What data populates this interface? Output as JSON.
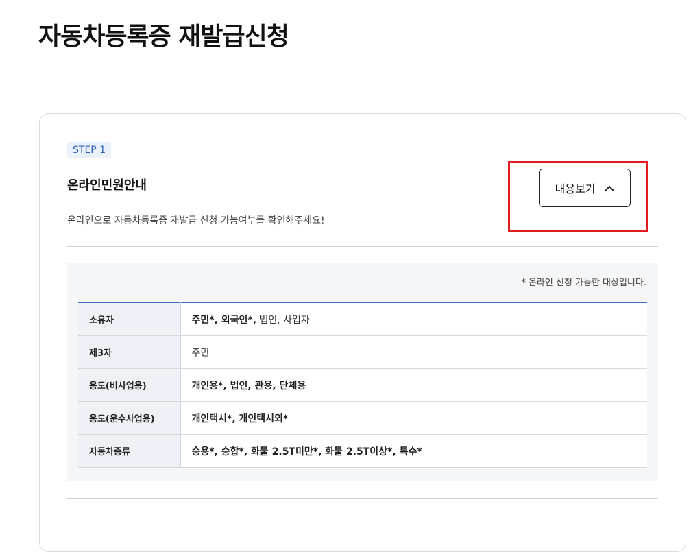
{
  "page": {
    "title": "자동차등록증 재발급신청"
  },
  "step": {
    "badge": "STEP 1",
    "title": "온라인민원안내",
    "description": "온라인으로 자동차등록증 재발급 신청 가능여부를 확인해주세요!",
    "toggle_label": "내용보기",
    "toggle_icon": "chevron-up-icon",
    "highlight_color": "#e31b23"
  },
  "panel": {
    "note": "* 온라인 신청 가능한 대상입니다.",
    "rows": [
      {
        "label": "소유자",
        "value_bold": "주민*, 외국인*,",
        "value_regular": " 법인, 사업자"
      },
      {
        "label": "제3자",
        "value_bold": "",
        "value_regular": "주민"
      },
      {
        "label": "용도(비사업용)",
        "value_bold": "개인용*, 법인, 관용, 단체용",
        "value_regular": ""
      },
      {
        "label": "용도(운수사업용)",
        "value_bold": "개인택시*, 개인택시외*",
        "value_regular": ""
      },
      {
        "label": "자동차종류",
        "value_bold": "승용*, 승합*, 화물 2.5T미만*, 화물 2.5T이상*, 특수*",
        "value_regular": ""
      }
    ]
  },
  "colors": {
    "table_top_border": "#3e6fc0",
    "badge_text": "#2a5fb8",
    "badge_bg": "#eaf1fb"
  }
}
